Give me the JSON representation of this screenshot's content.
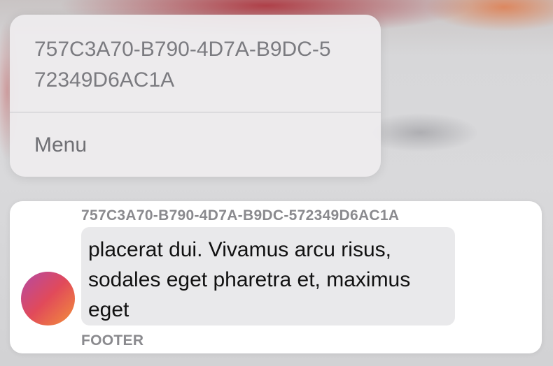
{
  "context_menu": {
    "title": "757C3A70-B790-4D7A-B9DC-572349D6AC1A",
    "items": [
      {
        "label": "Menu"
      }
    ]
  },
  "message": {
    "sender": "757C3A70-B790-4D7A-B9DC-572349D6AC1A",
    "text": "placerat dui. Vivamus arcu risus, sodales eget pharetra et, maximus eget",
    "footer": "FOOTER",
    "avatar_gradient": [
      "#b44aa4",
      "#e14a5a",
      "#f3903a"
    ]
  }
}
